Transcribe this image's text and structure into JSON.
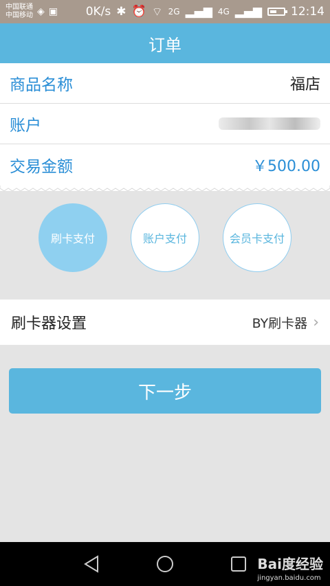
{
  "statusbar": {
    "carrier1": "中国联通",
    "carrier2": "中国移动",
    "speed": "0K/s",
    "net1": "2G",
    "net2": "4G",
    "time": "12:14"
  },
  "header": {
    "title": "订单"
  },
  "order": {
    "product_label": "商品名称",
    "product_value": "福店",
    "account_label": "账户",
    "amount_label": "交易金额",
    "amount_value": "￥500.00"
  },
  "payment_methods": [
    {
      "label": "刷卡支付",
      "selected": true
    },
    {
      "label": "账户支付",
      "selected": false
    },
    {
      "label": "会员卡支付",
      "selected": false
    }
  ],
  "settings": {
    "label": "刷卡器设置",
    "value": "BY刷卡器"
  },
  "next_button": {
    "label": "下一步"
  },
  "watermark": {
    "logo": "Bai度经验",
    "url": "jingyan.baidu.com"
  },
  "colors": {
    "accent": "#5ab6de",
    "label_blue": "#2a8ed6",
    "selected_circle": "#8fd0f0"
  }
}
